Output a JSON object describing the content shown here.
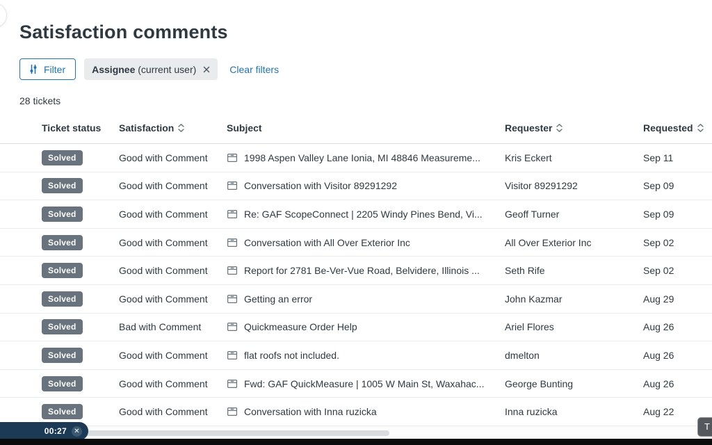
{
  "page": {
    "title": "Satisfaction comments",
    "ticket_count": "28 tickets"
  },
  "filters": {
    "filter_button_label": "Filter",
    "chip": {
      "name": "Assignee",
      "qualifier": "(current user)"
    },
    "clear_filters_label": "Clear filters"
  },
  "timer": {
    "value": "00:27"
  },
  "tooltip_partial": "T",
  "colors": {
    "accent_blue": "#1f73b7",
    "badge_grey": "#68737d",
    "text_dark": "#2f3941",
    "chip_bg": "#e9ebed",
    "timer_navy": "#1c3a56"
  },
  "table": {
    "columns": [
      {
        "label": "Ticket status",
        "sortable": false
      },
      {
        "label": "Satisfaction",
        "sortable": true
      },
      {
        "label": "Subject",
        "sortable": false
      },
      {
        "label": "Requester",
        "sortable": true
      },
      {
        "label": "Requested",
        "sortable": true
      }
    ],
    "rows": [
      {
        "status": "Solved",
        "satisfaction": "Good with Comment",
        "subject": "1998 Aspen Valley Lane Ionia, MI 48846 Measureme...",
        "requester": "Kris Eckert",
        "requested": "Sep 11"
      },
      {
        "status": "Solved",
        "satisfaction": "Good with Comment",
        "subject": "Conversation with Visitor 89291292",
        "requester": "Visitor 89291292",
        "requested": "Sep 09"
      },
      {
        "status": "Solved",
        "satisfaction": "Good with Comment",
        "subject": "Re: GAF ScopeConnect | 2205 Windy Pines Bend, Vi...",
        "requester": "Geoff Turner",
        "requested": "Sep 09"
      },
      {
        "status": "Solved",
        "satisfaction": "Good with Comment",
        "subject": "Conversation with All Over Exterior Inc",
        "requester": "All Over Exterior Inc",
        "requested": "Sep 02"
      },
      {
        "status": "Solved",
        "satisfaction": "Good with Comment",
        "subject": "Report for 2781 Be-Ver-Vue Road, Belvidere, Illinois ...",
        "requester": "Seth Rife",
        "requested": "Sep 02"
      },
      {
        "status": "Solved",
        "satisfaction": "Good with Comment",
        "subject": "Getting an error",
        "requester": "John Kazmar",
        "requested": "Aug 29"
      },
      {
        "status": "Solved",
        "satisfaction": "Bad with Comment",
        "subject": "Quickmeasure Order Help",
        "requester": "Ariel Flores",
        "requested": "Aug 26"
      },
      {
        "status": "Solved",
        "satisfaction": "Good with Comment",
        "subject": "flat roofs not included.",
        "requester": "dmelton",
        "requested": "Aug 26"
      },
      {
        "status": "Solved",
        "satisfaction": "Good with Comment",
        "subject": "Fwd: GAF QuickMeasure | 1005 W Main St, Waxahac...",
        "requester": "George Bunting",
        "requested": "Aug 26"
      },
      {
        "status": "Solved",
        "satisfaction": "Good with Comment",
        "subject": "Conversation with Inna ruzicka",
        "requester": "Inna ruzicka",
        "requested": "Aug 22"
      }
    ]
  }
}
